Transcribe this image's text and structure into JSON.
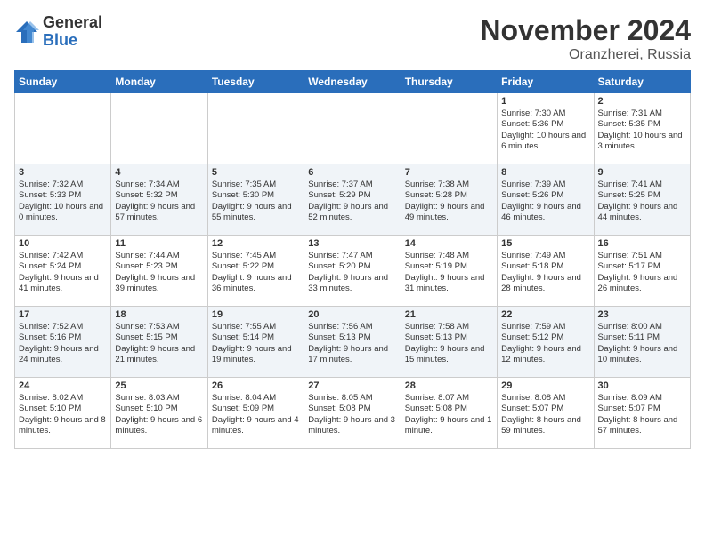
{
  "logo": {
    "general": "General",
    "blue": "Blue"
  },
  "title": "November 2024",
  "location": "Oranzherei, Russia",
  "days_of_week": [
    "Sunday",
    "Monday",
    "Tuesday",
    "Wednesday",
    "Thursday",
    "Friday",
    "Saturday"
  ],
  "weeks": [
    [
      {
        "day": "",
        "info": ""
      },
      {
        "day": "",
        "info": ""
      },
      {
        "day": "",
        "info": ""
      },
      {
        "day": "",
        "info": ""
      },
      {
        "day": "",
        "info": ""
      },
      {
        "day": "1",
        "info": "Sunrise: 7:30 AM\nSunset: 5:36 PM\nDaylight: 10 hours and 6 minutes."
      },
      {
        "day": "2",
        "info": "Sunrise: 7:31 AM\nSunset: 5:35 PM\nDaylight: 10 hours and 3 minutes."
      }
    ],
    [
      {
        "day": "3",
        "info": "Sunrise: 7:32 AM\nSunset: 5:33 PM\nDaylight: 10 hours and 0 minutes."
      },
      {
        "day": "4",
        "info": "Sunrise: 7:34 AM\nSunset: 5:32 PM\nDaylight: 9 hours and 57 minutes."
      },
      {
        "day": "5",
        "info": "Sunrise: 7:35 AM\nSunset: 5:30 PM\nDaylight: 9 hours and 55 minutes."
      },
      {
        "day": "6",
        "info": "Sunrise: 7:37 AM\nSunset: 5:29 PM\nDaylight: 9 hours and 52 minutes."
      },
      {
        "day": "7",
        "info": "Sunrise: 7:38 AM\nSunset: 5:28 PM\nDaylight: 9 hours and 49 minutes."
      },
      {
        "day": "8",
        "info": "Sunrise: 7:39 AM\nSunset: 5:26 PM\nDaylight: 9 hours and 46 minutes."
      },
      {
        "day": "9",
        "info": "Sunrise: 7:41 AM\nSunset: 5:25 PM\nDaylight: 9 hours and 44 minutes."
      }
    ],
    [
      {
        "day": "10",
        "info": "Sunrise: 7:42 AM\nSunset: 5:24 PM\nDaylight: 9 hours and 41 minutes."
      },
      {
        "day": "11",
        "info": "Sunrise: 7:44 AM\nSunset: 5:23 PM\nDaylight: 9 hours and 39 minutes."
      },
      {
        "day": "12",
        "info": "Sunrise: 7:45 AM\nSunset: 5:22 PM\nDaylight: 9 hours and 36 minutes."
      },
      {
        "day": "13",
        "info": "Sunrise: 7:47 AM\nSunset: 5:20 PM\nDaylight: 9 hours and 33 minutes."
      },
      {
        "day": "14",
        "info": "Sunrise: 7:48 AM\nSunset: 5:19 PM\nDaylight: 9 hours and 31 minutes."
      },
      {
        "day": "15",
        "info": "Sunrise: 7:49 AM\nSunset: 5:18 PM\nDaylight: 9 hours and 28 minutes."
      },
      {
        "day": "16",
        "info": "Sunrise: 7:51 AM\nSunset: 5:17 PM\nDaylight: 9 hours and 26 minutes."
      }
    ],
    [
      {
        "day": "17",
        "info": "Sunrise: 7:52 AM\nSunset: 5:16 PM\nDaylight: 9 hours and 24 minutes."
      },
      {
        "day": "18",
        "info": "Sunrise: 7:53 AM\nSunset: 5:15 PM\nDaylight: 9 hours and 21 minutes."
      },
      {
        "day": "19",
        "info": "Sunrise: 7:55 AM\nSunset: 5:14 PM\nDaylight: 9 hours and 19 minutes."
      },
      {
        "day": "20",
        "info": "Sunrise: 7:56 AM\nSunset: 5:13 PM\nDaylight: 9 hours and 17 minutes."
      },
      {
        "day": "21",
        "info": "Sunrise: 7:58 AM\nSunset: 5:13 PM\nDaylight: 9 hours and 15 minutes."
      },
      {
        "day": "22",
        "info": "Sunrise: 7:59 AM\nSunset: 5:12 PM\nDaylight: 9 hours and 12 minutes."
      },
      {
        "day": "23",
        "info": "Sunrise: 8:00 AM\nSunset: 5:11 PM\nDaylight: 9 hours and 10 minutes."
      }
    ],
    [
      {
        "day": "24",
        "info": "Sunrise: 8:02 AM\nSunset: 5:10 PM\nDaylight: 9 hours and 8 minutes."
      },
      {
        "day": "25",
        "info": "Sunrise: 8:03 AM\nSunset: 5:10 PM\nDaylight: 9 hours and 6 minutes."
      },
      {
        "day": "26",
        "info": "Sunrise: 8:04 AM\nSunset: 5:09 PM\nDaylight: 9 hours and 4 minutes."
      },
      {
        "day": "27",
        "info": "Sunrise: 8:05 AM\nSunset: 5:08 PM\nDaylight: 9 hours and 3 minutes."
      },
      {
        "day": "28",
        "info": "Sunrise: 8:07 AM\nSunset: 5:08 PM\nDaylight: 9 hours and 1 minute."
      },
      {
        "day": "29",
        "info": "Sunrise: 8:08 AM\nSunset: 5:07 PM\nDaylight: 8 hours and 59 minutes."
      },
      {
        "day": "30",
        "info": "Sunrise: 8:09 AM\nSunset: 5:07 PM\nDaylight: 8 hours and 57 minutes."
      }
    ]
  ]
}
